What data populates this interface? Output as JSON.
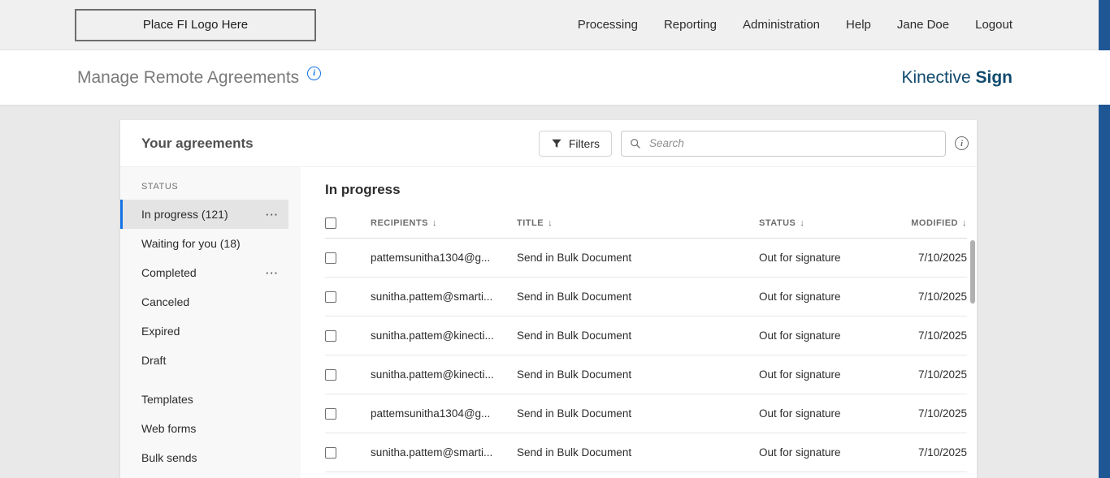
{
  "topbar": {
    "logo_text": "Place FI Logo Here",
    "nav": [
      "Processing",
      "Reporting",
      "Administration",
      "Help",
      "Jane Doe",
      "Logout"
    ]
  },
  "header": {
    "title": "Manage Remote Agreements",
    "brand_regular": "Kinective",
    "brand_bold": "Sign"
  },
  "colors": {
    "accent_blue": "#1473e6",
    "brand_navy": "#114a6d",
    "strip_blue": "#1f5795"
  },
  "icons": {
    "info": "i",
    "filter": "funnel-icon",
    "search": "magnifier-icon",
    "sort_arrow": "↓",
    "overflow_menu": "···"
  },
  "agreements": {
    "title": "Your agreements",
    "filters_label": "Filters",
    "search_placeholder": "Search",
    "sidebar": {
      "section_label": "STATUS",
      "items": [
        {
          "label": "In progress (121)",
          "selected": true,
          "menu": true
        },
        {
          "label": "Waiting for you (18)",
          "selected": false,
          "menu": false
        },
        {
          "label": "Completed",
          "selected": false,
          "menu": true
        },
        {
          "label": "Canceled",
          "selected": false,
          "menu": false
        },
        {
          "label": "Expired",
          "selected": false,
          "menu": false
        },
        {
          "label": "Draft",
          "selected": false,
          "menu": false
        }
      ],
      "extra_items": [
        {
          "label": "Templates"
        },
        {
          "label": "Web forms"
        },
        {
          "label": "Bulk sends"
        }
      ]
    },
    "table": {
      "heading": "In progress",
      "columns": [
        "RECIPIENTS",
        "TITLE",
        "STATUS",
        "MODIFIED"
      ],
      "rows": [
        {
          "recipient": "pattemsunitha1304@g...",
          "title": "Send in Bulk Document",
          "status": "Out for signature",
          "modified": "7/10/2025"
        },
        {
          "recipient": "sunitha.pattem@smarti...",
          "title": "Send in Bulk Document",
          "status": "Out for signature",
          "modified": "7/10/2025"
        },
        {
          "recipient": "sunitha.pattem@kinecti...",
          "title": "Send in Bulk Document",
          "status": "Out for signature",
          "modified": "7/10/2025"
        },
        {
          "recipient": "sunitha.pattem@kinecti...",
          "title": "Send in Bulk Document",
          "status": "Out for signature",
          "modified": "7/10/2025"
        },
        {
          "recipient": "pattemsunitha1304@g...",
          "title": "Send in Bulk Document",
          "status": "Out for signature",
          "modified": "7/10/2025"
        },
        {
          "recipient": "sunitha.pattem@smarti...",
          "title": "Send in Bulk Document",
          "status": "Out for signature",
          "modified": "7/10/2025"
        }
      ]
    }
  }
}
